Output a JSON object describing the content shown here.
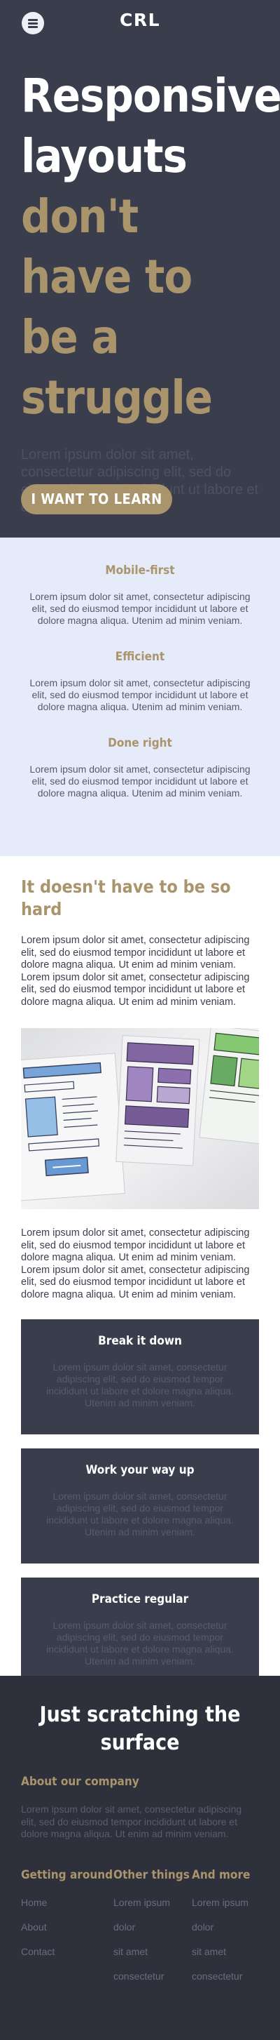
{
  "header": {
    "logo": "CRL",
    "menu_icon": "hamburger-menu-icon"
  },
  "hero": {
    "title_line1": "Responsive layouts",
    "title_line2": "don't have to be a struggle",
    "text": "Lorem ipsum dolor sit amet, consectetur adipiscing elit, sed do eiusmod tempor incididunt ut labore et dolore magna aliqua.",
    "cta_label": "I WANT TO LEARN"
  },
  "features": [
    {
      "title": "Mobile-first",
      "text": "Lorem ipsum dolor sit amet, consectetur adipiscing elit, sed do eiusmod tempor incididunt ut labore et dolore magna aliqua. Utenim ad minim veniam."
    },
    {
      "title": "Efficient",
      "text": "Lorem ipsum dolor sit amet, consectetur adipiscing elit, sed do eiusmod tempor incididunt ut labore et dolore magna aliqua. Utenim ad minim veniam."
    },
    {
      "title": "Done right",
      "text": "Lorem ipsum dolor sit amet, consectetur adipiscing elit, sed do eiusmod tempor incididunt ut labore et dolore magna aliqua. Utenim ad minim veniam."
    }
  ],
  "main": {
    "heading": "It doesn't have to be so hard",
    "para1": "Lorem ipsum dolor sit amet, consectetur adipiscing elit, sed do eiusmod tempor incididunt ut labore et dolore magna aliqua. Ut enim ad minim veniam. Lorem ipsum dolor sit amet, consectetur adipiscing elit, sed do eiusmod tempor incididunt ut labore et dolore magna aliqua. Ut enim ad minim veniam.",
    "para2": "Lorem ipsum dolor sit amet, consectetur adipiscing elit, sed do eiusmod tempor incididunt ut labore et dolore magna aliqua. Ut enim ad minim veniam. Lorem ipsum dolor sit amet, consectetur adipiscing elit, sed do eiusmod tempor incididunt ut labore et dolore magna aliqua. Ut enim ad minim veniam."
  },
  "cards": [
    {
      "title": "Break it down",
      "text": "Lorem ipsum dolor sit amet, consectetur adipiscing elit, sed do eiusmod tempor incididunt ut labore et dolore magna aliqua. Utenim ad minim veniam."
    },
    {
      "title": "Work your way up",
      "text": "Lorem ipsum dolor sit amet, consectetur adipiscing elit, sed do eiusmod tempor incididunt ut labore et dolore magna aliqua. Utenim ad minim veniam."
    },
    {
      "title": "Practice regular",
      "text": "Lorem ipsum dolor sit amet, consectetur adipiscing elit, sed do eiusmod tempor incididunt ut labore et dolore magna aliqua. Utenim ad minim veniam."
    }
  ],
  "footer": {
    "heading": "Just scratching the surface",
    "about_title": "About our company",
    "about_text": "Lorem ipsum dolor sit amet, consectetur adipiscing elit, sed do eiusmod tempor incididunt ut labore et dolore magna aliqua. Ut enim ad minim veniam.",
    "columns": [
      {
        "title": "Getting around",
        "links": [
          "Home",
          "About",
          "Contact"
        ]
      },
      {
        "title": "Other things",
        "links": [
          "Lorem ipsum",
          "dolor",
          "sit amet",
          "consectetur"
        ]
      },
      {
        "title": "And more",
        "links": [
          "Lorem ipsum",
          "dolor",
          "sit amet",
          "consectetur"
        ]
      }
    ]
  },
  "colors": {
    "dark": "#3a3d4b",
    "footer_dark": "#2e303b",
    "accent": "#a9946c",
    "light_band": "#e6ebfa"
  }
}
